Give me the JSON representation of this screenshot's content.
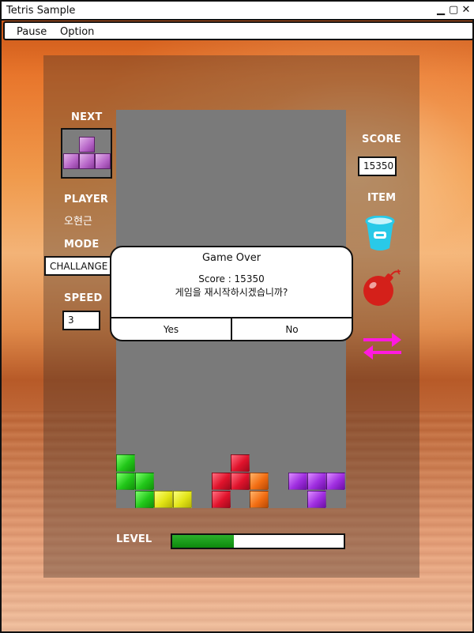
{
  "window": {
    "title": "Tetris Sample",
    "controls": {
      "minimize": "▁",
      "maximize": "▢",
      "close": "✕"
    }
  },
  "menu": [
    {
      "label": "Pause"
    },
    {
      "label": "Option"
    }
  ],
  "left_panel": {
    "next_label": "NEXT",
    "player_label": "PLAYER",
    "player_name": "오현근",
    "mode_label": "MODE",
    "mode_value": "CHALLANGE",
    "speed_label": "SPEED",
    "speed_value": "3"
  },
  "right_panel": {
    "score_label": "SCORE",
    "score_value": "15350",
    "item_label": "ITEM",
    "items": [
      {
        "name": "bucket-icon",
        "color": "#29c9e8"
      },
      {
        "name": "bomb-icon",
        "color": "#d4201a"
      },
      {
        "name": "swap-arrows-icon",
        "color": "#ff19e0"
      }
    ]
  },
  "dialog": {
    "title": "Game Over",
    "score_text": "Score : 15350",
    "message": "게임을 재시작하시겠습니까?",
    "yes_label": "Yes",
    "no_label": "No"
  },
  "level": {
    "label": "LEVEL",
    "progress": 0.36,
    "fill_color": "#1a9e1a"
  },
  "colors": {
    "piece_green": "#22c81a",
    "piece_yellow": "#e2e416",
    "piece_red": "#e0132c",
    "piece_orange": "#f26d12",
    "piece_purple": "#9f2ee0",
    "next_piece": "#b664c7"
  }
}
